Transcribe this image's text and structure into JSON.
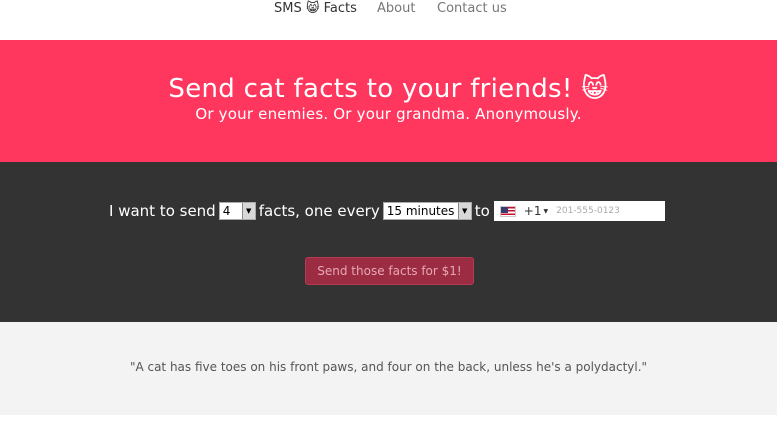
{
  "nav": {
    "brand_prefix": "SMS",
    "brand_icon": "😸",
    "brand_suffix": "Facts",
    "about": "About",
    "contact": "Contact us"
  },
  "hero": {
    "title": "Send cat facts to your friends! 😸",
    "subtitle": "Or your enemies. Or your grandma. Anonymously."
  },
  "form": {
    "text_intro": "I want to send",
    "count_value": "4",
    "text_mid": "facts, one every",
    "interval_value": "15 minutes",
    "text_to": "to",
    "country_flag_icon": "us-flag-icon",
    "dial_code": "+1",
    "phone_placeholder": "201-555-0123",
    "send_button": "Send those facts for $1!"
  },
  "quote": {
    "text": "\"A cat has five toes on his front paws, and four on the back, unless he's a polydactyl.\""
  },
  "colors": {
    "hero_bg": "#ff375f",
    "form_bg": "#333333",
    "quote_bg": "#f3f3f3",
    "button_bg": "#9b2c42"
  }
}
